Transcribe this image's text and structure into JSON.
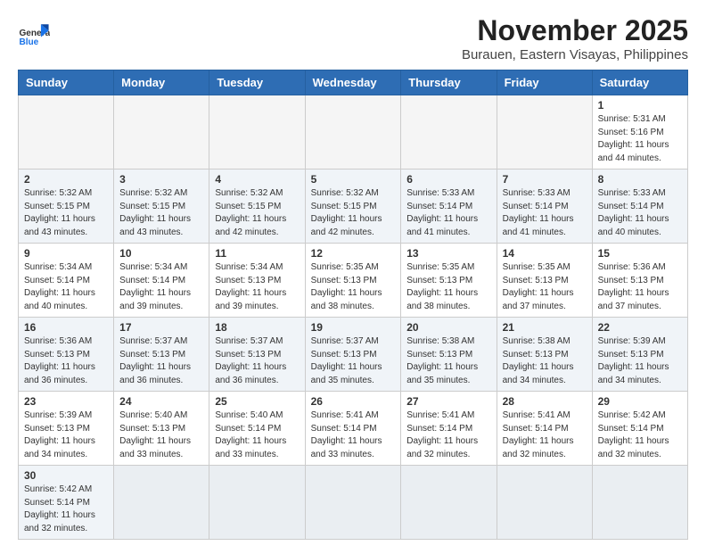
{
  "header": {
    "title": "November 2025",
    "subtitle": "Burauen, Eastern Visayas, Philippines",
    "logo_general": "General",
    "logo_blue": "Blue"
  },
  "days_of_week": [
    "Sunday",
    "Monday",
    "Tuesday",
    "Wednesday",
    "Thursday",
    "Friday",
    "Saturday"
  ],
  "weeks": [
    [
      {
        "day": "",
        "info": ""
      },
      {
        "day": "",
        "info": ""
      },
      {
        "day": "",
        "info": ""
      },
      {
        "day": "",
        "info": ""
      },
      {
        "day": "",
        "info": ""
      },
      {
        "day": "",
        "info": ""
      },
      {
        "day": "1",
        "info": "Sunrise: 5:31 AM\nSunset: 5:16 PM\nDaylight: 11 hours\nand 44 minutes."
      }
    ],
    [
      {
        "day": "2",
        "info": "Sunrise: 5:32 AM\nSunset: 5:15 PM\nDaylight: 11 hours\nand 43 minutes."
      },
      {
        "day": "3",
        "info": "Sunrise: 5:32 AM\nSunset: 5:15 PM\nDaylight: 11 hours\nand 43 minutes."
      },
      {
        "day": "4",
        "info": "Sunrise: 5:32 AM\nSunset: 5:15 PM\nDaylight: 11 hours\nand 42 minutes."
      },
      {
        "day": "5",
        "info": "Sunrise: 5:32 AM\nSunset: 5:15 PM\nDaylight: 11 hours\nand 42 minutes."
      },
      {
        "day": "6",
        "info": "Sunrise: 5:33 AM\nSunset: 5:14 PM\nDaylight: 11 hours\nand 41 minutes."
      },
      {
        "day": "7",
        "info": "Sunrise: 5:33 AM\nSunset: 5:14 PM\nDaylight: 11 hours\nand 41 minutes."
      },
      {
        "day": "8",
        "info": "Sunrise: 5:33 AM\nSunset: 5:14 PM\nDaylight: 11 hours\nand 40 minutes."
      }
    ],
    [
      {
        "day": "9",
        "info": "Sunrise: 5:34 AM\nSunset: 5:14 PM\nDaylight: 11 hours\nand 40 minutes."
      },
      {
        "day": "10",
        "info": "Sunrise: 5:34 AM\nSunset: 5:14 PM\nDaylight: 11 hours\nand 39 minutes."
      },
      {
        "day": "11",
        "info": "Sunrise: 5:34 AM\nSunset: 5:13 PM\nDaylight: 11 hours\nand 39 minutes."
      },
      {
        "day": "12",
        "info": "Sunrise: 5:35 AM\nSunset: 5:13 PM\nDaylight: 11 hours\nand 38 minutes."
      },
      {
        "day": "13",
        "info": "Sunrise: 5:35 AM\nSunset: 5:13 PM\nDaylight: 11 hours\nand 38 minutes."
      },
      {
        "day": "14",
        "info": "Sunrise: 5:35 AM\nSunset: 5:13 PM\nDaylight: 11 hours\nand 37 minutes."
      },
      {
        "day": "15",
        "info": "Sunrise: 5:36 AM\nSunset: 5:13 PM\nDaylight: 11 hours\nand 37 minutes."
      }
    ],
    [
      {
        "day": "16",
        "info": "Sunrise: 5:36 AM\nSunset: 5:13 PM\nDaylight: 11 hours\nand 36 minutes."
      },
      {
        "day": "17",
        "info": "Sunrise: 5:37 AM\nSunset: 5:13 PM\nDaylight: 11 hours\nand 36 minutes."
      },
      {
        "day": "18",
        "info": "Sunrise: 5:37 AM\nSunset: 5:13 PM\nDaylight: 11 hours\nand 36 minutes."
      },
      {
        "day": "19",
        "info": "Sunrise: 5:37 AM\nSunset: 5:13 PM\nDaylight: 11 hours\nand 35 minutes."
      },
      {
        "day": "20",
        "info": "Sunrise: 5:38 AM\nSunset: 5:13 PM\nDaylight: 11 hours\nand 35 minutes."
      },
      {
        "day": "21",
        "info": "Sunrise: 5:38 AM\nSunset: 5:13 PM\nDaylight: 11 hours\nand 34 minutes."
      },
      {
        "day": "22",
        "info": "Sunrise: 5:39 AM\nSunset: 5:13 PM\nDaylight: 11 hours\nand 34 minutes."
      }
    ],
    [
      {
        "day": "23",
        "info": "Sunrise: 5:39 AM\nSunset: 5:13 PM\nDaylight: 11 hours\nand 34 minutes."
      },
      {
        "day": "24",
        "info": "Sunrise: 5:40 AM\nSunset: 5:13 PM\nDaylight: 11 hours\nand 33 minutes."
      },
      {
        "day": "25",
        "info": "Sunrise: 5:40 AM\nSunset: 5:14 PM\nDaylight: 11 hours\nand 33 minutes."
      },
      {
        "day": "26",
        "info": "Sunrise: 5:41 AM\nSunset: 5:14 PM\nDaylight: 11 hours\nand 33 minutes."
      },
      {
        "day": "27",
        "info": "Sunrise: 5:41 AM\nSunset: 5:14 PM\nDaylight: 11 hours\nand 32 minutes."
      },
      {
        "day": "28",
        "info": "Sunrise: 5:41 AM\nSunset: 5:14 PM\nDaylight: 11 hours\nand 32 minutes."
      },
      {
        "day": "29",
        "info": "Sunrise: 5:42 AM\nSunset: 5:14 PM\nDaylight: 11 hours\nand 32 minutes."
      }
    ],
    [
      {
        "day": "30",
        "info": "Sunrise: 5:42 AM\nSunset: 5:14 PM\nDaylight: 11 hours\nand 32 minutes."
      },
      {
        "day": "",
        "info": ""
      },
      {
        "day": "",
        "info": ""
      },
      {
        "day": "",
        "info": ""
      },
      {
        "day": "",
        "info": ""
      },
      {
        "day": "",
        "info": ""
      },
      {
        "day": "",
        "info": ""
      }
    ]
  ]
}
